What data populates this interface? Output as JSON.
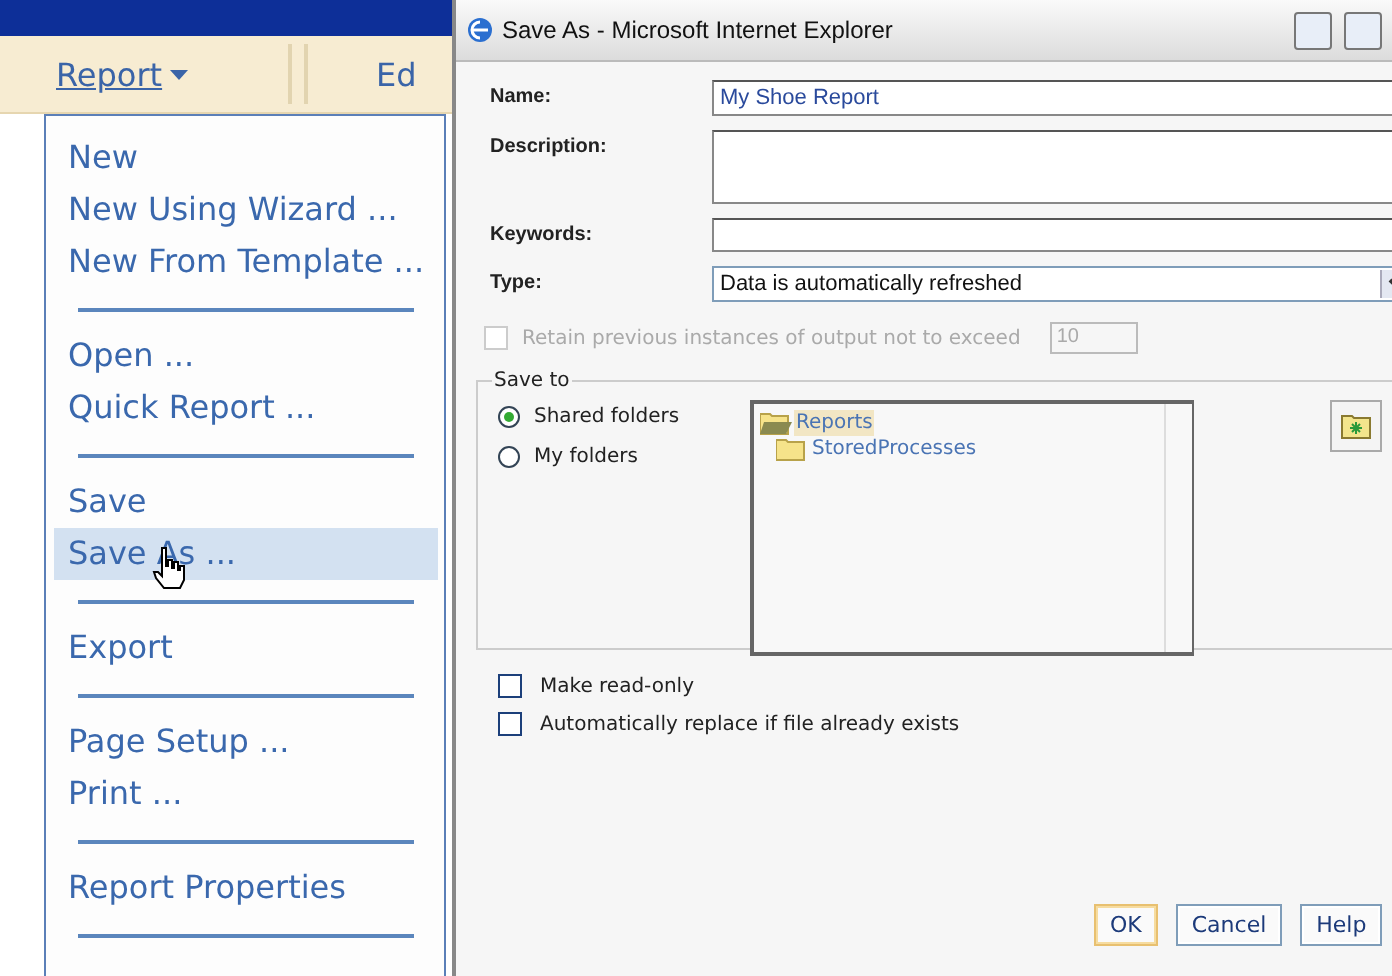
{
  "menubar": {
    "items": [
      {
        "label": "Report",
        "selected": true
      },
      {
        "label": "Ed",
        "selected": false
      }
    ]
  },
  "menu": {
    "groups": [
      [
        {
          "label": "New",
          "selected": false
        },
        {
          "label": "New Using Wizard ...",
          "selected": false
        },
        {
          "label": "New From Template ...",
          "selected": false
        }
      ],
      [
        {
          "label": "Open ...",
          "selected": false
        },
        {
          "label": "Quick Report ...",
          "selected": false
        }
      ],
      [
        {
          "label": "Save",
          "selected": false
        },
        {
          "label": "Save As ...",
          "selected": true
        }
      ],
      [
        {
          "label": "Export",
          "selected": false
        }
      ],
      [
        {
          "label": "Page Setup ...",
          "selected": false
        },
        {
          "label": "Print ...",
          "selected": false
        }
      ],
      [
        {
          "label": "Report Properties",
          "selected": false
        }
      ]
    ]
  },
  "dialog": {
    "title": "Save As - Microsoft Internet Explorer",
    "name": {
      "label": "Name:",
      "value": "My Shoe Report"
    },
    "description": {
      "label": "Description:"
    },
    "keywords": {
      "label": "Keywords:"
    },
    "type": {
      "label": "Type:",
      "value": "Data is automatically refreshed"
    },
    "retain": {
      "label": "Retain previous instances of output not to exceed",
      "checked": false,
      "disabled": true,
      "value": "10"
    },
    "save_to": {
      "label": "Save to",
      "radios": [
        {
          "label": "Shared folders",
          "selected": true
        },
        {
          "label": "My folders",
          "selected": false
        }
      ],
      "tree": [
        {
          "label": "Reports",
          "selected": true,
          "expanded": true,
          "children": [
            {
              "label": "StoredProcesses",
              "selected": false,
              "expanded": false
            }
          ]
        }
      ]
    },
    "options": [
      {
        "label": "Make read-only",
        "checked": false
      },
      {
        "label": "Automatically replace if file already exists",
        "checked": false
      }
    ],
    "buttons": [
      {
        "label": "OK",
        "default": true
      },
      {
        "label": "Cancel",
        "default": false
      },
      {
        "label": "Help",
        "default": false
      }
    ]
  }
}
